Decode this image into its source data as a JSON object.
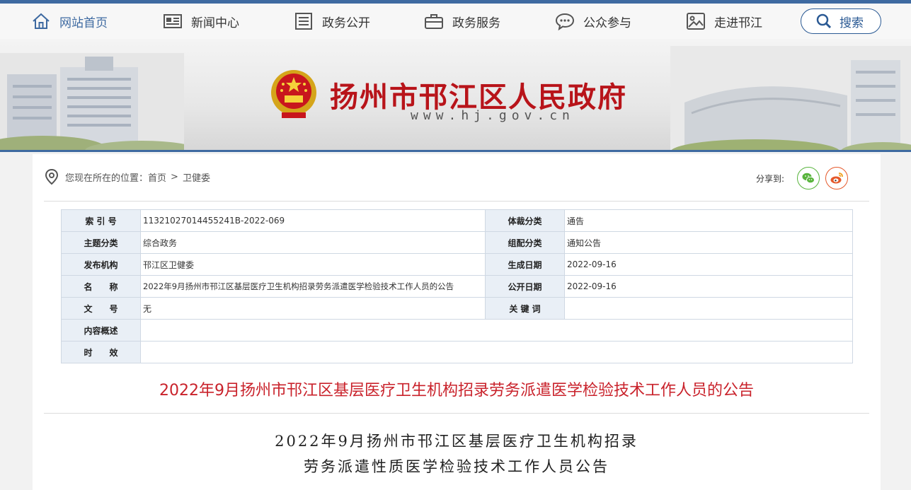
{
  "nav": {
    "items": [
      {
        "label": "网站首页",
        "icon": "home-icon"
      },
      {
        "label": "新闻中心",
        "icon": "newspaper-icon"
      },
      {
        "label": "政务公开",
        "icon": "list-icon"
      },
      {
        "label": "政务服务",
        "icon": "briefcase-icon"
      },
      {
        "label": "公众参与",
        "icon": "chat-icon"
      },
      {
        "label": "走进邗江",
        "icon": "picture-icon"
      }
    ],
    "search_label": "搜索"
  },
  "banner": {
    "title": "扬州市邗江区人民政府",
    "url": "www.hj.gov.cn"
  },
  "breadcrumb": {
    "prefix": "您现在所在的位置：",
    "home": "首页",
    "separator": ">",
    "current": "卫健委"
  },
  "share": {
    "label": "分享到:"
  },
  "meta": {
    "rows": [
      {
        "k1": "索 引 号",
        "v1": "11321027014455241B-2022-069",
        "k2": "体裁分类",
        "v2": "通告"
      },
      {
        "k1": "主题分类",
        "v1": "综合政务",
        "k2": "组配分类",
        "v2": "通知公告"
      },
      {
        "k1": "发布机构",
        "v1": "邗江区卫健委",
        "k2": "生成日期",
        "v2": "2022-09-16"
      },
      {
        "k1": "名　　称",
        "v1": "2022年9月扬州市邗江区基层医疗卫生机构招录劳务派遣医学检验技术工作人员的公告",
        "k2": "公开日期",
        "v2": "2022-09-16"
      },
      {
        "k1": "文　　号",
        "v1": "无",
        "k2": "关 键 词",
        "v2": ""
      }
    ],
    "summary_label": "内容概述",
    "summary_value": "",
    "validity_label": "时　　效",
    "validity_value": ""
  },
  "article": {
    "title": "2022年9月扬州市邗江区基层医疗卫生机构招录劳务派遣医学检验技术工作人员的公告",
    "doc_title_line1": "2022年9月扬州市邗江区基层医疗卫生机构招录",
    "doc_title_line2": "劳务派遣性质医学检验技术工作人员公告"
  },
  "colors": {
    "accent": "#3e6aa1",
    "title_red": "#b8141a",
    "article_red": "#c9222b"
  }
}
